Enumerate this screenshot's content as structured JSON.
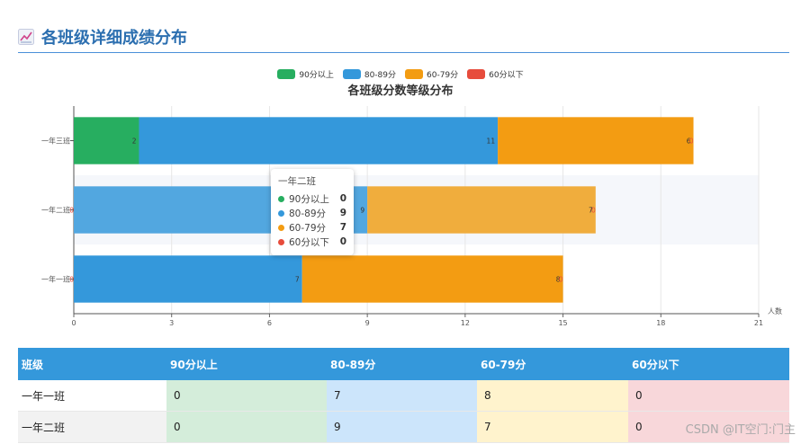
{
  "section": {
    "icon": "chart-up-icon",
    "title": "各班级详细成绩分布"
  },
  "legend": [
    {
      "label": "90分以上",
      "color": "#27ae60"
    },
    {
      "label": "80-89分",
      "color": "#3498db"
    },
    {
      "label": "60-79分",
      "color": "#f39c12"
    },
    {
      "label": "60分以下",
      "color": "#e74c3c"
    }
  ],
  "chart_data": {
    "type": "bar",
    "orientation": "horizontal",
    "stacked": true,
    "title": "各班级分数等级分布",
    "xlabel": "人数",
    "ylabel": "",
    "xlim": [
      0,
      21
    ],
    "xticks": [
      "0",
      "3",
      "6",
      "9",
      "12",
      "15",
      "18",
      "21"
    ],
    "categories": [
      "一年一班",
      "一年二班",
      "一年三班"
    ],
    "series": [
      {
        "name": "90分以上",
        "color": "#27ae60",
        "values": [
          0,
          0,
          2
        ]
      },
      {
        "name": "80-89分",
        "color": "#3498db",
        "values": [
          7,
          9,
          11
        ]
      },
      {
        "name": "60-79分",
        "color": "#f39c12",
        "values": [
          8,
          7,
          6
        ]
      },
      {
        "name": "60分以下",
        "color": "#e74c3c",
        "values": [
          0,
          0,
          0
        ]
      }
    ],
    "highlighted_category": "一年二班",
    "grid": true,
    "legend_position": "top-center"
  },
  "tooltip": {
    "title": "一年二班",
    "rows": [
      {
        "name": "90分以上",
        "value": "0",
        "color": "#27ae60"
      },
      {
        "name": "80-89分",
        "value": "9",
        "color": "#3498db"
      },
      {
        "name": "60-79分",
        "value": "7",
        "color": "#f39c12"
      },
      {
        "name": "60分以下",
        "value": "0",
        "color": "#e74c3c"
      }
    ]
  },
  "table": {
    "headers": [
      "班级",
      "90分以上",
      "80-89分",
      "60-79分",
      "60分以下"
    ],
    "rows": [
      [
        "一年一班",
        "0",
        "7",
        "8",
        "0"
      ],
      [
        "一年二班",
        "0",
        "9",
        "7",
        "0"
      ]
    ]
  },
  "watermark": "CSDN @IT空门:门主"
}
